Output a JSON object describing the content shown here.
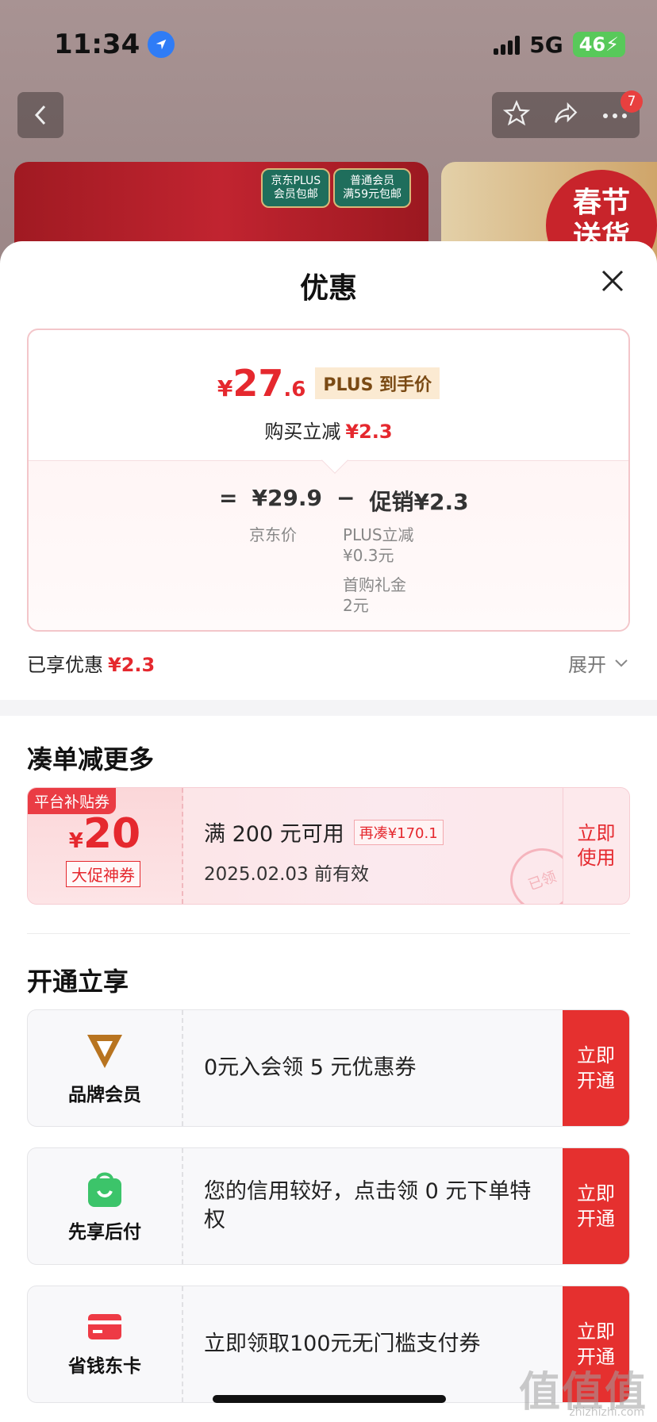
{
  "status_bar": {
    "time": "11:34",
    "network": "5G",
    "battery": "46"
  },
  "top_nav": {
    "more_badge": "7"
  },
  "banner": {
    "tag_plus": "京东PLUS\n会员包邮",
    "tag_normal": "普通会员\n满59元包邮",
    "right_text": "春节\n送货"
  },
  "sheet": {
    "title": "优惠",
    "price_card": {
      "currency": "¥",
      "final_int": "27",
      "final_dec": ".6",
      "plus_tag": "PLUS 到手价",
      "reduce_label": "购买立减",
      "reduce_value": "¥2.3",
      "equals": "=",
      "jd_price": "¥29.9",
      "jd_price_label": "京东价",
      "minus": "−",
      "promo": "促销¥2.3",
      "promo_detail_1": "PLUS立减\n¥0.3元",
      "promo_detail_2": "首购礼金\n2元"
    },
    "enjoyed_label": "已享优惠",
    "enjoyed_value": "¥2.3",
    "expand_label": "展开",
    "section_more": "凑单减更多",
    "coupon": {
      "flag": "平台补贴券",
      "currency": "¥",
      "amount": "20",
      "kind": "大促神券",
      "condition": "满 200 元可用",
      "add_more": "再凑¥170.1",
      "expiry": "2025.02.03 前有效",
      "button": "立即\n使用",
      "stamp": "已领"
    },
    "section_open": "开通立享",
    "members": [
      {
        "label": "品牌会员",
        "text": "0元入会领 5 元优惠券",
        "button": "立即\n开通"
      },
      {
        "label": "先享后付",
        "text": "您的信用较好，点击领 0 元下单特权",
        "button": "立即\n开通"
      },
      {
        "label": "省钱东卡",
        "text": "立即领取100元无门槛支付券",
        "button": "立即\n开通"
      }
    ]
  },
  "watermark": {
    "text": "值值值",
    "sub": "zhizhizhi.com"
  },
  "colors": {
    "accent_red": "#e5282e",
    "button_red": "#e5302f",
    "plus_gold": "#7a4a14"
  }
}
